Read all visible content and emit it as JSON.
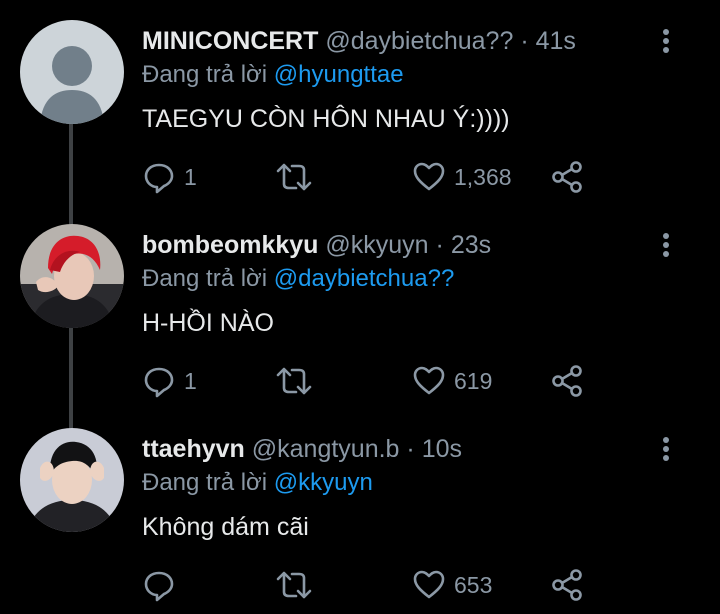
{
  "replying_prefix": "Đang trả lời",
  "tweets": [
    {
      "name": "MINICONCERT",
      "handle": "@daybietchua??",
      "separator": "·",
      "time": "41s",
      "reply_to": "@hyungttae",
      "text": "TAEGYU CÒN HÔN NHAU Ý:))))",
      "replies": "1",
      "retweets": "",
      "likes": "1,368",
      "avatar": "default-avatar"
    },
    {
      "name": "bombeomkkyu",
      "handle": "@kkyuyn",
      "separator": "·",
      "time": "23s",
      "reply_to": "@daybietchua??",
      "text": "H-HỒI NÀO",
      "replies": "1",
      "retweets": "",
      "likes": "619",
      "avatar": "red-hair-photo"
    },
    {
      "name": "ttaehyvn",
      "handle": "@kangtyun.b",
      "separator": "·",
      "time": "10s",
      "reply_to": "@kkyuyn",
      "text": "Không dám cãi",
      "replies": "",
      "retweets": "",
      "likes": "653",
      "avatar": "dark-hair-photo"
    }
  ],
  "colors": {
    "background": "#000000",
    "text": "#e7e9ea",
    "muted": "#8b98a5",
    "accent": "#1d9bf0"
  }
}
